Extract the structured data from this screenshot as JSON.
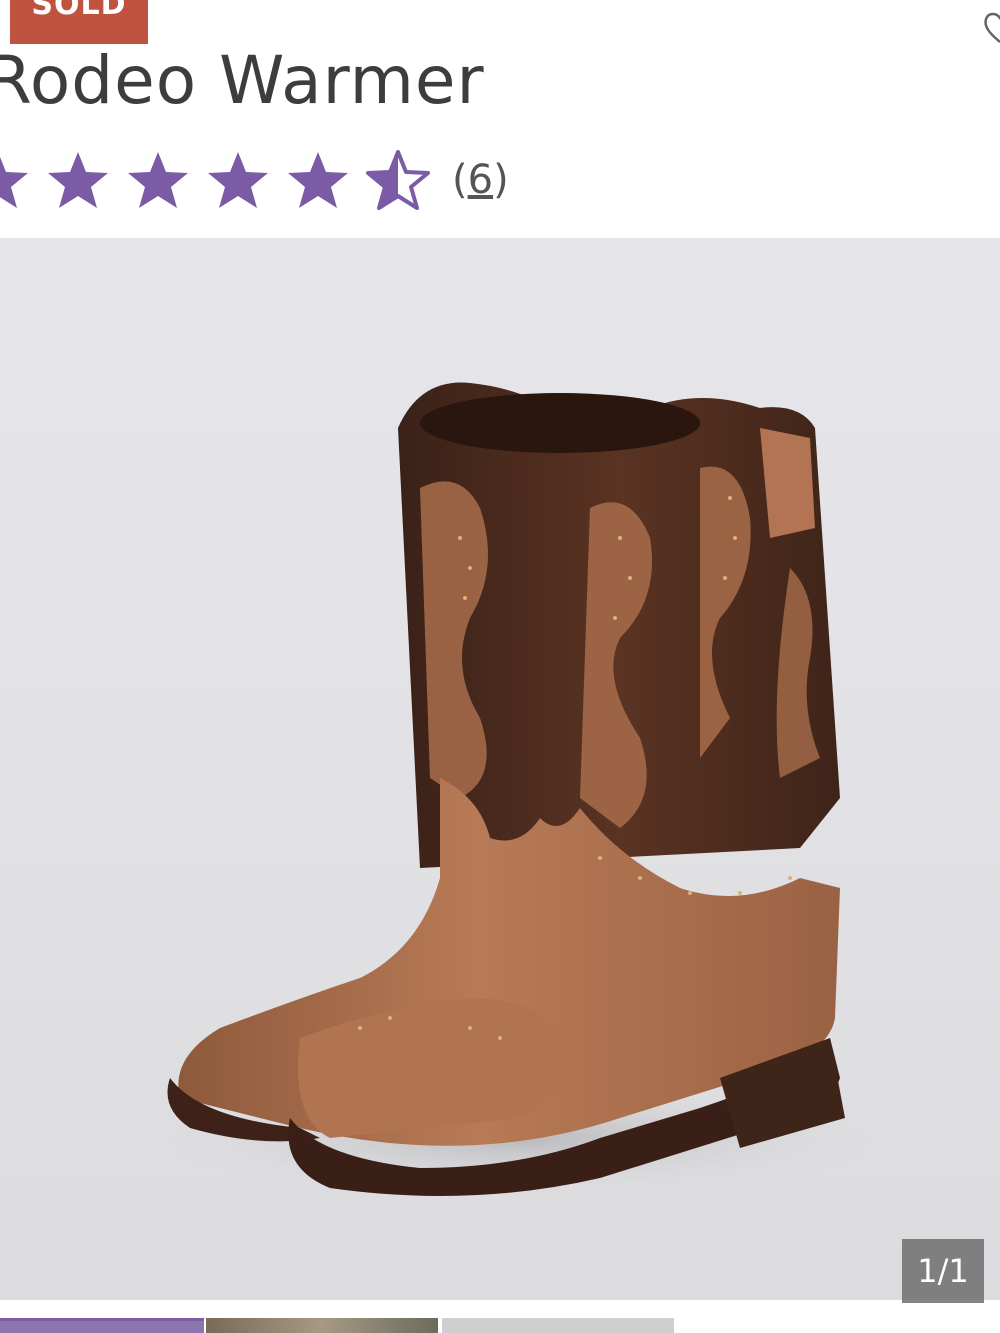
{
  "badge": {
    "label": "SOLD"
  },
  "product": {
    "title": "Rodeo Warmer"
  },
  "rating": {
    "value": 4.5,
    "max": 5,
    "open_paren": "(",
    "count": "6",
    "close_paren": ")",
    "star_color": "#7b5aa6"
  },
  "gallery": {
    "counter": "1/1"
  },
  "icons": {
    "favorite": "heart-outline-icon",
    "star": "star-icon",
    "half_star": "star-half-icon"
  },
  "colors": {
    "sold_badge": "#c0533f",
    "title_text": "#3d3d3d",
    "accent": "#7b5aa6"
  }
}
